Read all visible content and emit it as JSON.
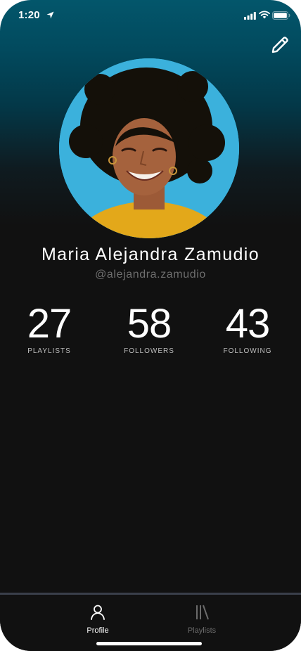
{
  "status_bar": {
    "time": "1:20"
  },
  "profile": {
    "name": "Maria Alejandra Zamudio",
    "handle": "@alejandra.zamudio"
  },
  "stats": [
    {
      "value": "27",
      "label": "PLAYLISTS"
    },
    {
      "value": "58",
      "label": "FOLLOWERS"
    },
    {
      "value": "43",
      "label": "FOLLOWING"
    }
  ],
  "tabs": [
    {
      "label": "Profile",
      "icon": "person-icon",
      "active": true
    },
    {
      "label": "Playlists",
      "icon": "library-icon",
      "active": false
    }
  ],
  "colors": {
    "header_teal": "#03566b",
    "background": "#111111",
    "active_tab": "#ffffff",
    "inactive_tab": "#6b6b6b",
    "avatar_backdrop": "#3bb1dc"
  }
}
